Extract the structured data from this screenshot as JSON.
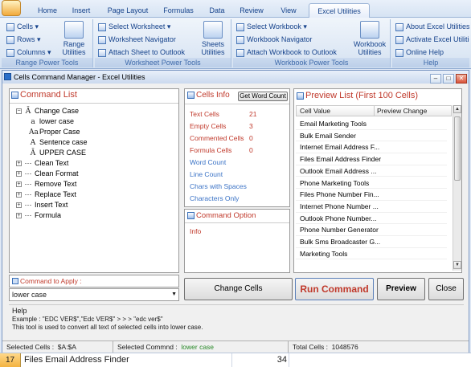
{
  "ribbon": {
    "tabs": [
      "Home",
      "Insert",
      "Page Layout",
      "Formulas",
      "Data",
      "Review",
      "View",
      "Excel Utilities"
    ],
    "active_tab": "Excel Utilities",
    "range_group": {
      "label": "Range Power Tools",
      "cells": "Cells",
      "rows": "Rows",
      "columns": "Columns",
      "range_utilities": "Range Utilities"
    },
    "worksheet_group": {
      "label": "Worksheet Power Tools",
      "select_worksheet": "Select Worksheet",
      "worksheet_navigator": "Worksheet Navigator",
      "attach_sheet": "Attach Sheet to Outlook",
      "sheets_utilities": "Sheets Utilities"
    },
    "workbook_group": {
      "label": "Workbook Power Tools",
      "select_workbook": "Select Workbook",
      "workbook_navigator": "Workbook Navigator",
      "attach_workbook": "Attach Workbook to Outlook",
      "workbook_utilities": "Workbook Utilities"
    },
    "help_group": {
      "label": "Help",
      "about": "About Excel Utilities",
      "activate": "Activate Excel Utilities",
      "online_help": "Online Help"
    }
  },
  "dialog": {
    "title": "Cells Command Manager - Excel Utilities",
    "command_list": {
      "title": "Command List",
      "items": [
        {
          "label": "Change Case",
          "expanded": "−",
          "icon": "Ā"
        },
        {
          "label": "lower case",
          "icon": "a"
        },
        {
          "label": "Proper Case",
          "icon": "Aa"
        },
        {
          "label": "Sentence case",
          "icon": "A"
        },
        {
          "label": "UPPER CASE",
          "icon": "Ā"
        },
        {
          "label": "Clean Text",
          "expanded": "+"
        },
        {
          "label": "Clean Format",
          "expanded": "+"
        },
        {
          "label": "Remove Text",
          "expanded": "+"
        },
        {
          "label": "Replace Text",
          "expanded": "+"
        },
        {
          "label": "Insert Text",
          "expanded": "+"
        },
        {
          "label": "Formula",
          "expanded": "+"
        }
      ]
    },
    "command_to_apply": {
      "label": "Command to Apply :",
      "value": "lower case"
    },
    "cells_info": {
      "title": "Cells Info",
      "get_word_count": "Get Word Count",
      "rows": [
        {
          "label": "Text Cells",
          "value": "21",
          "color": "red"
        },
        {
          "label": "Empty Cells",
          "value": "3",
          "color": "red"
        },
        {
          "label": "Commented Cells",
          "value": "0",
          "color": "red"
        },
        {
          "label": "Formula Cells",
          "value": "0",
          "color": "red"
        },
        {
          "label": "Word Count",
          "value": "",
          "color": "blue"
        },
        {
          "label": "Line Count",
          "value": "",
          "color": "blue"
        },
        {
          "label": "Chars with Spaces",
          "value": "",
          "color": "blue"
        },
        {
          "label": "Characters Only",
          "value": "",
          "color": "blue"
        }
      ]
    },
    "command_option": {
      "title": "Command Option",
      "info": "Info"
    },
    "preview": {
      "title": "Preview List (First 100 Cells)",
      "col_cell_value": "Cell Value",
      "col_preview_change": "Preview Change",
      "rows": [
        "Email Marketing Tools",
        "Bulk Email Sender",
        "Internet Email Address F...",
        "Files Email Address Finder",
        "Outlook Email Address ...",
        "Phone Marketing Tools",
        "Files Phone Number Fin...",
        "Internet Phone Number ...",
        "Outlook Phone Number...",
        "Phone Number Generator",
        "Bulk Sms Broadcaster G...",
        "Marketing Tools"
      ]
    },
    "buttons": {
      "change_cells": "Change Cells",
      "run_command": "Run Command",
      "preview": "Preview",
      "close": "Close"
    },
    "help": {
      "title": "Help",
      "example": "Example : \"EDC VER$\",\"Edc VER$\" > > > \"edc ver$\"",
      "text": "This tool is used to convert all text of selected cells into lower case."
    },
    "status": {
      "selected_cells_label": "Selected Cells :",
      "selected_cells_value": "$A:$A",
      "selected_command_label": "Selected Commnd :",
      "selected_command_value": "lower case",
      "total_cells_label": "Total Cells :",
      "total_cells_value": "1048576"
    }
  },
  "sheet": {
    "row_number": "17",
    "cell_text": "Files Email Address Finder",
    "cell_value": "34"
  }
}
